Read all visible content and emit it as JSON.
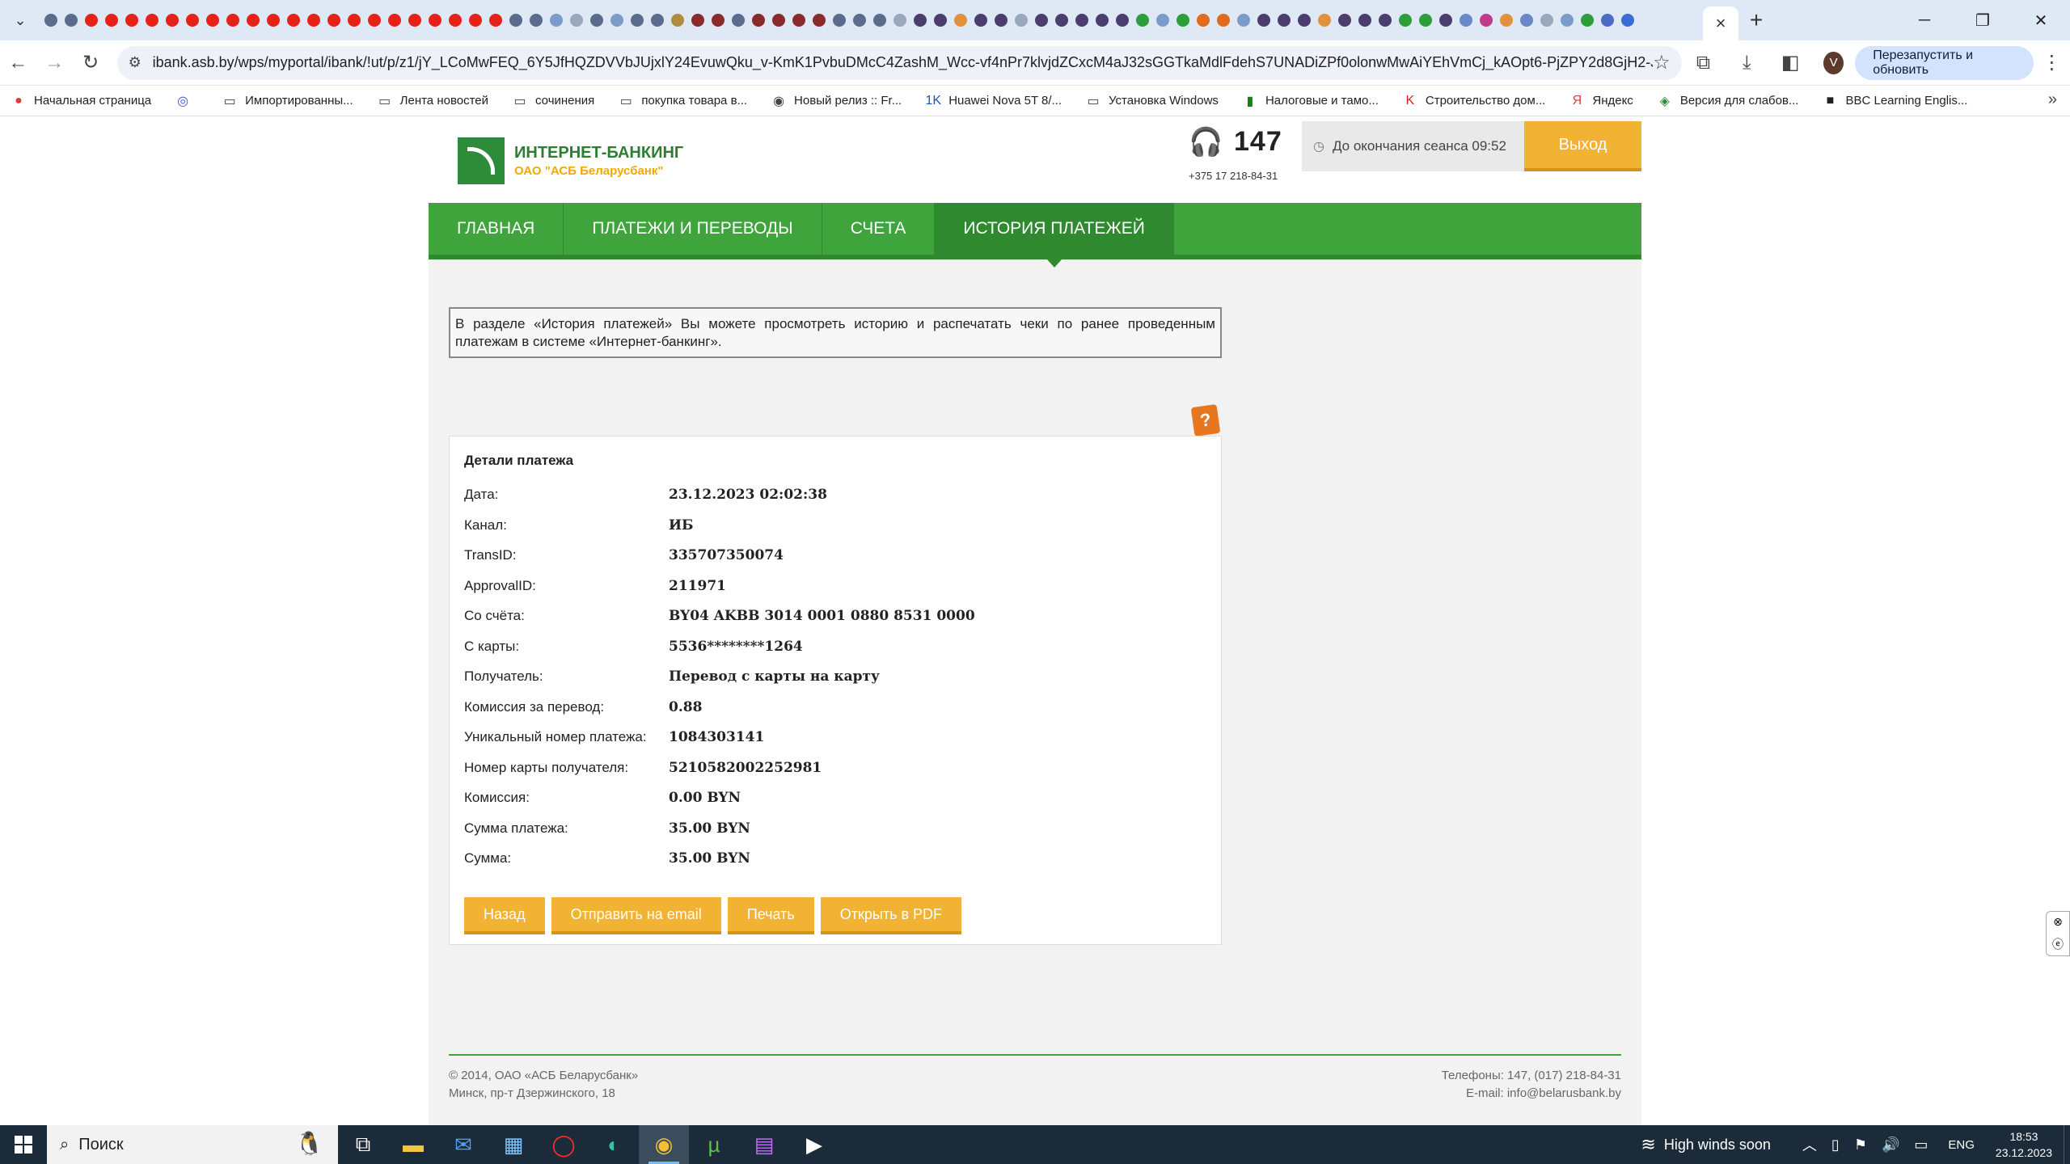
{
  "browser": {
    "url": "ibank.asb.by/wps/myportal/ibank/!ut/p/z1/jY_LCoMwFEQ_6Y5JfHQZDVVbJUjxlY24EvuwQku_v-KmK1PvbuDMcC4ZashM_Wcc-vf4nPr7klvjdZCxcM4aJ32sGGTkaMdlFdehS7UNADiZPf0olonwMwAiYEhVmCj_kAOpt6-PjZPY2d8GjH2-JrMitg_-bbSL...",
    "relaunch_label": "Перезапустить и обновить",
    "avatar_letter": "V",
    "tab_close": "×",
    "new_tab": "+",
    "mini_tab_colors": [
      "#5a6b8c",
      "#5a6b8c",
      "#e62117",
      "#e62117",
      "#e62117",
      "#e62117",
      "#e62117",
      "#e62117",
      "#e62117",
      "#e62117",
      "#e62117",
      "#e62117",
      "#e62117",
      "#e62117",
      "#e62117",
      "#e62117",
      "#e62117",
      "#e62117",
      "#e62117",
      "#e62117",
      "#e62117",
      "#e62117",
      "#e62117",
      "#5a6b8c",
      "#5a6b8c",
      "#7b9cc9",
      "#9aa8bb",
      "#5a6b8c",
      "#7b9cc9",
      "#5a6b8c",
      "#5a6b8c",
      "#b08d3e",
      "#8a2a2a",
      "#8a2a2a",
      "#5a6b8c",
      "#8a2a2a",
      "#8a2a2a",
      "#8a2a2a",
      "#8a2a2a",
      "#5a6b8c",
      "#5a6b8c",
      "#5a6b8c",
      "#9aa8bb",
      "#4b3d6e",
      "#4b3d6e",
      "#e0913a",
      "#4b3d6e",
      "#4b3d6e",
      "#9aa8bb",
      "#4b3d6e",
      "#4b3d6e",
      "#4b3d6e",
      "#4b3d6e",
      "#4b3d6e",
      "#2e9e3a",
      "#7b9cc9",
      "#2e9e3a",
      "#e06b1a",
      "#e06b1a",
      "#7b9cc9",
      "#4b3d6e",
      "#4b3d6e",
      "#4b3d6e",
      "#e0913a",
      "#4b3d6e",
      "#4b3d6e",
      "#4b3d6e",
      "#2e9e3a",
      "#2e9e3a",
      "#4b3d6e",
      "#6a88c7",
      "#c23a8a",
      "#e0913a",
      "#6a88c7",
      "#9aa8bb",
      "#7b9cc9",
      "#2e9e3a",
      "#4b6bc4",
      "#3b6bd4"
    ]
  },
  "bookmarks": [
    {
      "label": "Начальная страница",
      "icon": "●",
      "color": "#e23b3b"
    },
    {
      "label": "",
      "icon": "◎",
      "color": "#3b5bd1"
    },
    {
      "label": "Импортированны...",
      "icon": "▭",
      "color": "#444"
    },
    {
      "label": "Лента новостей",
      "icon": "▭",
      "color": "#444"
    },
    {
      "label": "сочинения",
      "icon": "▭",
      "color": "#444"
    },
    {
      "label": "покупка товара в...",
      "icon": "▭",
      "color": "#444"
    },
    {
      "label": "Новый релиз  :: Fr...",
      "icon": "◉",
      "color": "#444"
    },
    {
      "label": "Huawei Nova 5T 8/...",
      "icon": "1K",
      "color": "#1a55c4"
    },
    {
      "label": "Установка Windows",
      "icon": "▭",
      "color": "#444"
    },
    {
      "label": "Налоговые и тамо...",
      "icon": "▮",
      "color": "#1a7d1a"
    },
    {
      "label": "Строительство дом...",
      "icon": "K",
      "color": "#d6202a"
    },
    {
      "label": "Яндекс",
      "icon": "Я",
      "color": "#e23b3b"
    },
    {
      "label": "Версия для слабов...",
      "icon": "◈",
      "color": "#2e8b3a"
    },
    {
      "label": "BBC Learning Englis...",
      "icon": "■",
      "color": "#222"
    }
  ],
  "header": {
    "logo_title": "ИНТЕРНЕТ-БАНКИНГ",
    "logo_subtitle": "ОАО \"АСБ Беларусбанк\"",
    "phone_short": "147",
    "phone_full": "+375 17 218-84-31",
    "session_label": "До окончания сеанса 09:52",
    "logout_label": "Выход"
  },
  "nav": [
    {
      "label": "ГЛАВНАЯ",
      "active": false
    },
    {
      "label": "ПЛАТЕЖИ И ПЕРЕВОДЫ",
      "active": false
    },
    {
      "label": "СЧЕТА",
      "active": false
    },
    {
      "label": "ИСТОРИЯ ПЛАТЕЖЕЙ",
      "active": true
    }
  ],
  "intro_text": "В разделе «История платежей» Вы можете просмотреть историю и распечатать чеки по ранее проведенным платежам в системе «Интернет-банкинг».",
  "details": {
    "title": "Детали платежа",
    "rows": [
      {
        "label": "Дата:",
        "value": "23.12.2023 02:02:38"
      },
      {
        "label": "Канал:",
        "value": "ИБ"
      },
      {
        "label": "TransID:",
        "value": "335707350074"
      },
      {
        "label": "ApprovalID:",
        "value": "211971"
      },
      {
        "label": "Со счёта:",
        "value": "BY04 AKBB 3014 0001 0880 8531 0000"
      },
      {
        "label": "С карты:",
        "value": "5536********1264"
      },
      {
        "label": "Получатель:",
        "value": "Перевод с карты на карту"
      },
      {
        "label": "Комиссия за перевод:",
        "value": "0.88"
      },
      {
        "label": "Уникальный номер платежа:",
        "value": "1084303141"
      },
      {
        "label": "Номер карты получателя:",
        "value": "5210582002252981"
      },
      {
        "label": "Комиссия:",
        "value": "0.00 BYN"
      },
      {
        "label": "Сумма платежа:",
        "value": "35.00 BYN"
      },
      {
        "label": "Сумма:",
        "value": "35.00 BYN"
      }
    ],
    "buttons": {
      "back": "Назад",
      "email": "Отправить на email",
      "print": "Печать",
      "pdf": "Открыть в PDF"
    }
  },
  "footer": {
    "copyright": "© 2014, ОАО «АСБ Беларусбанк»",
    "address": "Минск, пр-т Дзержинского, 18",
    "phones": "Телефоны: 147, (017) 218-84-31",
    "email": "E-mail: info@belarusbank.by"
  },
  "taskbar": {
    "search_placeholder": "Поиск",
    "weather": "High winds soon",
    "lang": "ENG",
    "time": "18:53",
    "date": "23.12.2023"
  }
}
